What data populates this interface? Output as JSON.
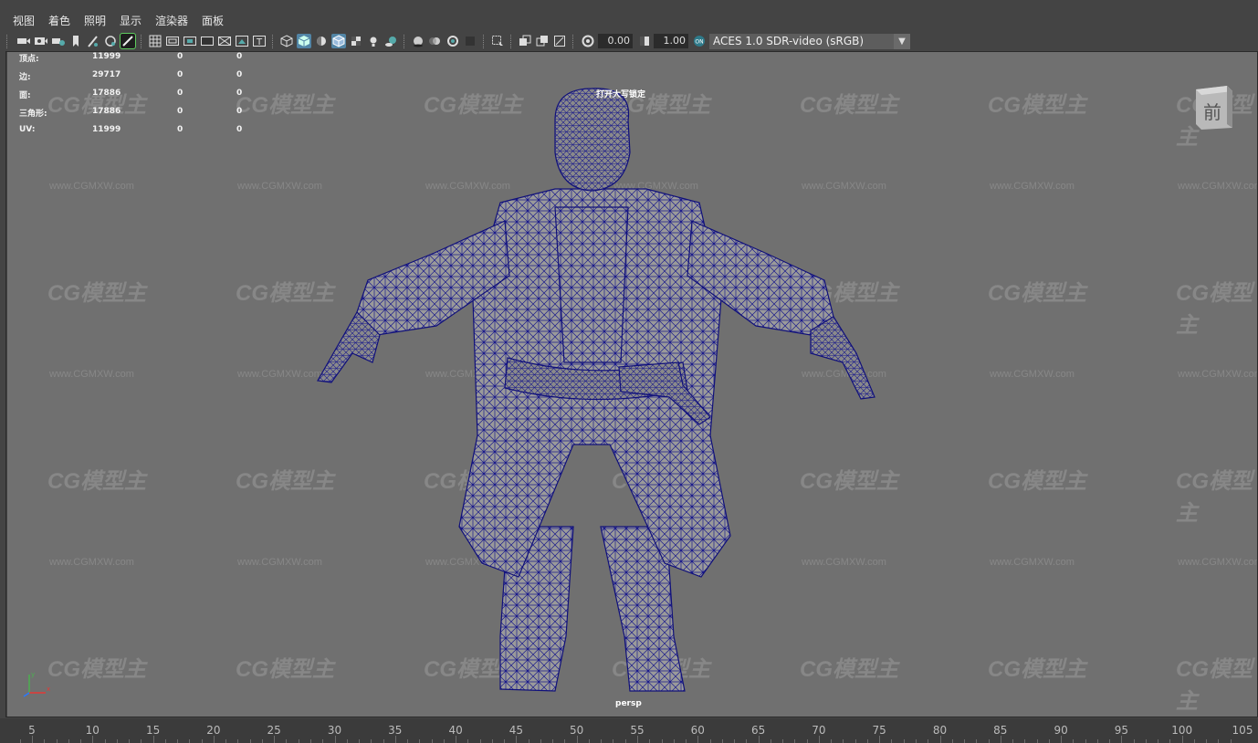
{
  "menu": [
    "视图",
    "着色",
    "照明",
    "显示",
    "渲染器",
    "面板"
  ],
  "toolbar": {
    "exposure": "0.00",
    "gamma": "1.00",
    "color_space": "ACES 1.0 SDR-video (sRGB)"
  },
  "stats": [
    {
      "label": "顶点:",
      "v1": "11999",
      "v2": "0",
      "v3": "0"
    },
    {
      "label": "边:",
      "v1": "29717",
      "v2": "0",
      "v3": "0"
    },
    {
      "label": "面:",
      "v1": "17886",
      "v2": "0",
      "v3": "0"
    },
    {
      "label": "三角形:",
      "v1": "17886",
      "v2": "0",
      "v3": "0"
    },
    {
      "label": "UV:",
      "v1": "11999",
      "v2": "0",
      "v3": "0"
    }
  ],
  "viewport": {
    "caps_lock_msg": "打开大写锁定",
    "camera_name": "persp",
    "view_cube_label": "前",
    "watermark_logo": "CG模型主",
    "watermark_url": "www.CGMXW.com",
    "wireframe_color": "#1a1a8c",
    "background_color": "#707070"
  },
  "timeline": {
    "ticks": [
      "5",
      "10",
      "15",
      "20",
      "25",
      "30",
      "35",
      "40",
      "45",
      "50",
      "55",
      "60",
      "65",
      "70",
      "75",
      "80",
      "85",
      "90",
      "95",
      "100",
      "105"
    ]
  },
  "icons": [
    "camera-icon",
    "camera-attributes-icon",
    "bookmark-icon",
    "image-plane-icon",
    "grid-icon",
    "film-gate-icon",
    "resolution-gate-icon",
    "gate-mask-icon",
    "field-chart-icon",
    "safe-action-icon",
    "safe-title-icon",
    "wireframe-icon",
    "smooth-shade-icon",
    "default-material-icon",
    "wireframe-on-shaded-icon",
    "textured-icon",
    "lighting-icon",
    "shadows-icon",
    "ambient-occlusion-icon",
    "motion-blur-icon",
    "anti-aliasing-icon",
    "isolate-select-icon",
    "xray-icon",
    "xray-joints-icon",
    "xray-components-icon",
    "exposure-icon",
    "gamma-icon",
    "color-management-icon"
  ]
}
